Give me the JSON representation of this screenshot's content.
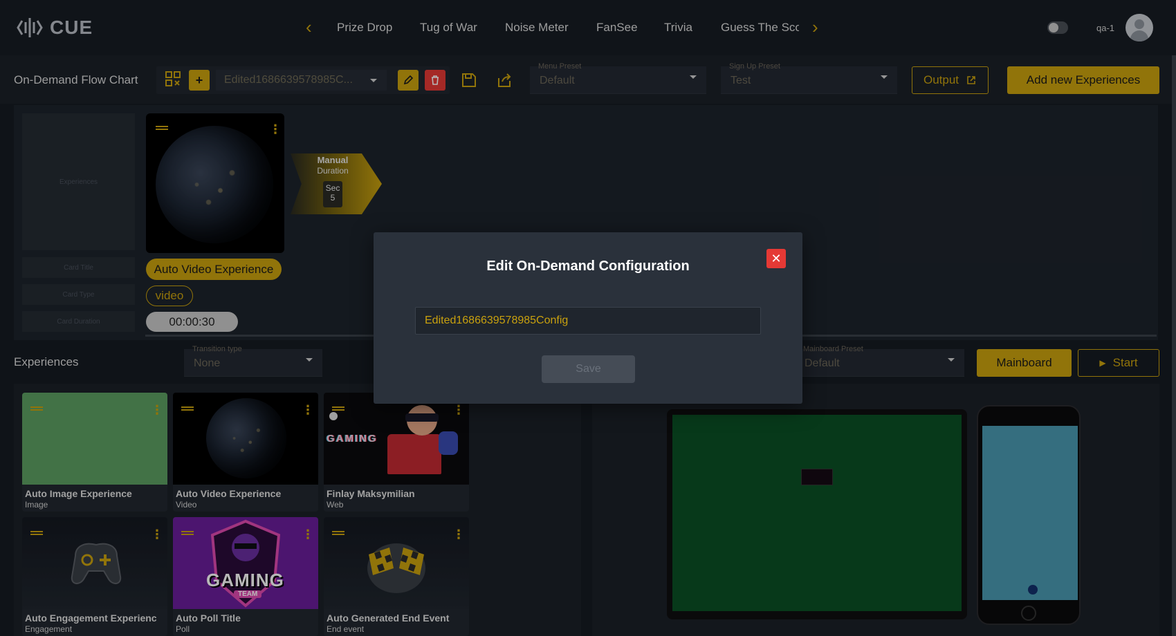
{
  "app": {
    "name": "CUE",
    "user": "qa-1"
  },
  "nav": {
    "items": [
      "Prize Drop",
      "Tug of War",
      "Noise Meter",
      "FanSee",
      "Trivia",
      "Guess The Sco"
    ]
  },
  "toolbar": {
    "title": "On-Demand Flow Chart",
    "config_name": "Edited1686639578985C...",
    "menu_preset": {
      "label": "Menu Preset",
      "value": "Default"
    },
    "signup_preset": {
      "label": "Sign Up Preset",
      "value": "Test"
    },
    "output_label": "Output",
    "add_label": "Add new Experiences"
  },
  "flow": {
    "placeholders": [
      "Experiences",
      "Card Title",
      "Card Type",
      "Card Duration"
    ],
    "card": {
      "title": "Auto Video Experience",
      "type": "video",
      "duration": "00:00:30"
    },
    "transition": {
      "mode": "Manual",
      "sub": "Duration",
      "unit": "Sec",
      "value": "5"
    }
  },
  "experiences": {
    "title": "Experiences",
    "transition_type": {
      "label": "Transition type",
      "value": "None"
    },
    "mainboard_preset": {
      "label": "Mainboard Preset",
      "value": "Default"
    },
    "mainboard_label": "Mainboard",
    "start_label": "Start",
    "tiles": [
      {
        "title": "Auto Image Experience",
        "type": "Image"
      },
      {
        "title": "Auto Video Experience",
        "type": "Video"
      },
      {
        "title": "Finlay Maksymilian",
        "type": "Web"
      },
      {
        "title": "Auto Engagement Experienc",
        "type": "Engagement"
      },
      {
        "title": "Auto Poll Title",
        "type": "Poll"
      },
      {
        "title": "Auto Generated End Event",
        "type": "End event"
      }
    ],
    "gaming_text": "GAMING",
    "team_text": "TEAM"
  },
  "modal": {
    "title": "Edit On-Demand Configuration",
    "field_value": "Edited1686639578985Config",
    "save_label": "Save"
  },
  "colors": {
    "accent": "#c9a10e",
    "danger": "#e53935",
    "bg": "#161b22"
  }
}
